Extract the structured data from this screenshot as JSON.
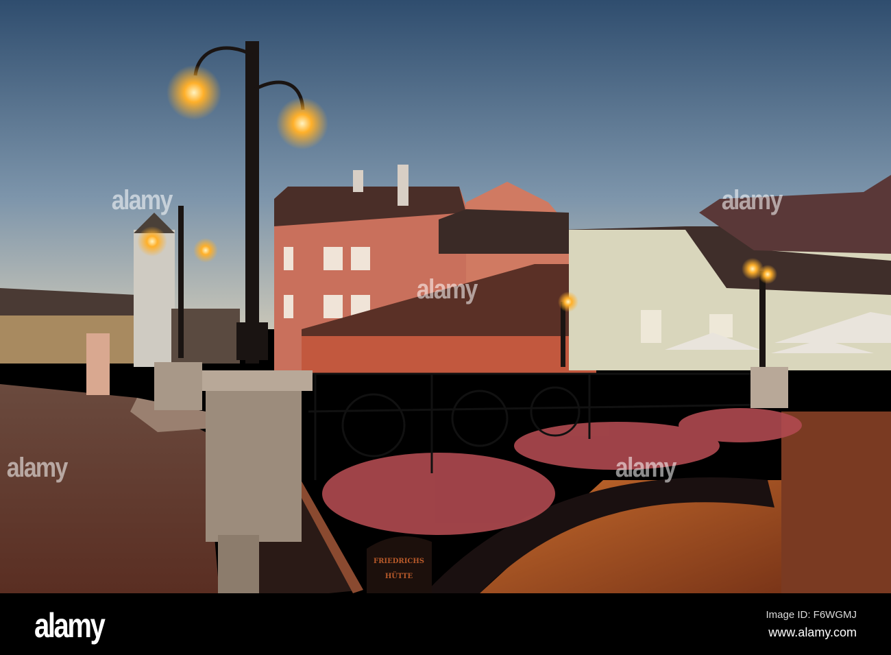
{
  "watermark": "alamy",
  "sign": {
    "line1": "FRIEDRICHS",
    "line2": "HÜTTE"
  },
  "footer": {
    "logo": "alamy",
    "image_id": "Image ID: F6WGMJ",
    "site": "www.alamy.com"
  },
  "colors": {
    "sky_top": "#2f4d6e",
    "sky_horizon": "#c9c6b8",
    "lamp_glow": "#ffb02a",
    "building_pink": "#c9705c",
    "footer_bg": "#000000"
  }
}
